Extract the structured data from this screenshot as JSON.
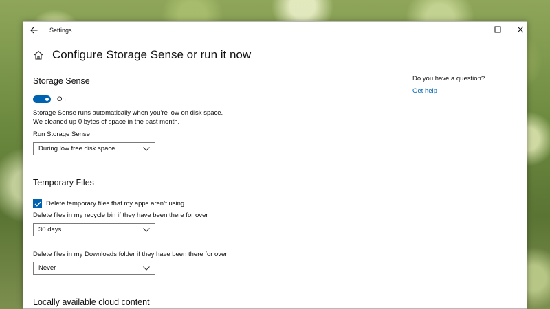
{
  "window": {
    "title": "Settings",
    "controls": {
      "minimize": "─",
      "maximize": "☐",
      "close": "✕"
    }
  },
  "page": {
    "title": "Configure Storage Sense or run it now"
  },
  "storage_sense": {
    "heading": "Storage Sense",
    "toggle": {
      "state": "On",
      "on": true,
      "color": "#0063b1"
    },
    "description_line1": "Storage Sense runs automatically when you’re low on disk space.",
    "description_line2": "We cleaned up 0 bytes of space in the past month.",
    "run_label": "Run Storage Sense",
    "run_value": "During low free disk space"
  },
  "temporary_files": {
    "heading": "Temporary Files",
    "delete_temp_label": "Delete temporary files that my apps aren’t using",
    "delete_temp_checked": true,
    "recycle_bin_label": "Delete files in my recycle bin if they have been there for over",
    "recycle_bin_value": "30 days",
    "downloads_label": "Delete files in my Downloads folder if they have been there for over",
    "downloads_value": "Never"
  },
  "cloud": {
    "heading": "Locally available cloud content"
  },
  "help": {
    "question": "Do you have a question?",
    "link": "Get help",
    "link_color": "#0063b1"
  },
  "icons": {
    "back": "back-arrow-icon",
    "home": "home-icon",
    "dropdown": "chevron-down-icon",
    "check": "checkmark-icon"
  }
}
